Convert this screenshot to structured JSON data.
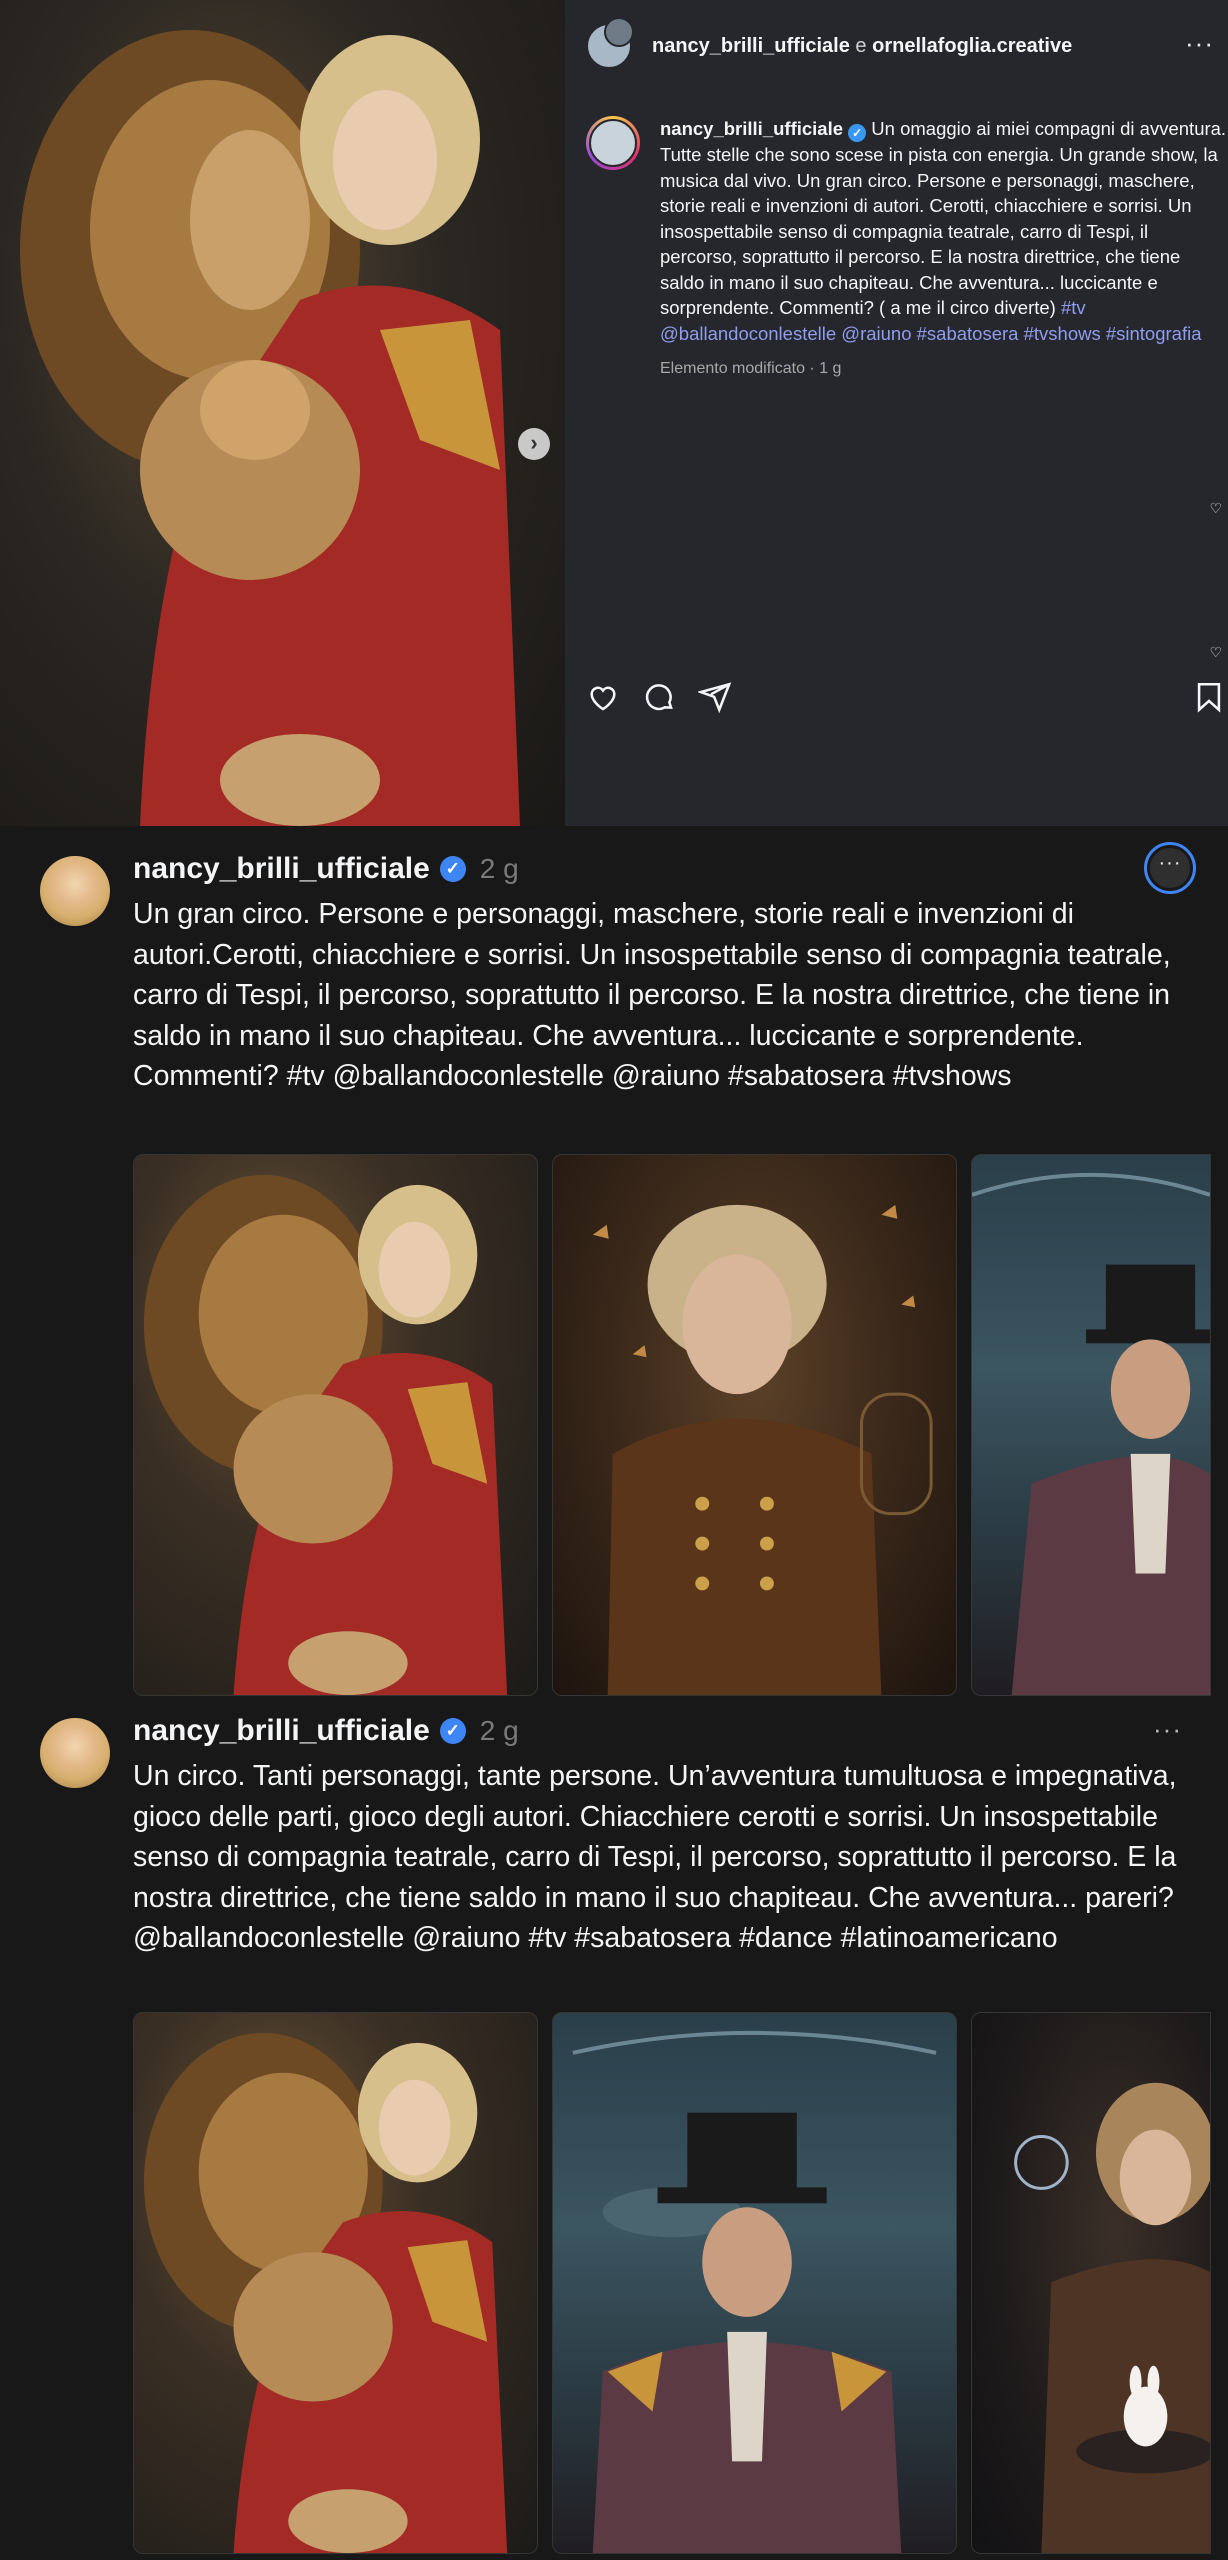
{
  "ig": {
    "header_user1": "nancy_brilli_ufficiale",
    "header_sep": "e",
    "header_user2": "ornellafoglia.creative",
    "caption_user": "nancy_brilli_ufficiale",
    "caption_text": "Un omaggio ai miei compagni di avventura. Tutte stelle che sono scese in pista con energia. Un grande show, la musica dal vivo. Un gran circo. Persone e personaggi, maschere, storie reali e invenzioni di autori. Cerotti, chiacchiere e sorrisi. Un insospettabile senso di compagnia teatrale, carro di Tespi, il percorso, soprattutto il percorso. E la nostra direttrice, che tiene saldo in mano il suo chapiteau. Che avventura... luccicante e sorprendente. Commenti? ( a me il circo diverte)",
    "caption_tags": "#tv @ballandoconlestelle @raiuno #sabatosera #tvshows #sintografia",
    "meta": "Elemento modificato · 1 g",
    "more_icon": "···",
    "next_icon": "›"
  },
  "posts": [
    {
      "user": "nancy_brilli_ufficiale",
      "time": "2 g",
      "text": "Un gran circo. Persone e personaggi, maschere, storie reali e invenzioni di autori.Cerotti, chiacchiere e sorrisi. Un insospettabile senso di compagnia teatrale, carro di Tespi, il percorso, soprattutto il percorso. E la nostra direttrice, che tiene in saldo in mano il suo chapiteau. Che avventura... luccicante e sorprendente. Commenti? #tv @ballandoconlestelle @raiuno #sabatosera #tvshows",
      "menu": "···"
    },
    {
      "user": "nancy_brilli_ufficiale",
      "time": "2 g",
      "text": "Un circo. Tanti personaggi, tante persone. Un’avventura tumultuosa e impegnativa, gioco delle parti, gioco degli autori. Chiacchiere cerotti e sorrisi. Un insospettabile senso di compagnia teatrale, carro di Tespi, il percorso, soprattutto il percorso. E la nostra direttrice, che tiene saldo in mano il suo chapiteau. Che avventura... pareri? @ballandoconlestelle @raiuno #tv #sabatosera #dance #latinoamericano",
      "menu": "···"
    }
  ],
  "verified_mark": "✓",
  "colors": {
    "accent_blue": "#3e85f5",
    "tag_color": "#8f9df0",
    "bg": "#181818",
    "ig_bg": "#25272c"
  }
}
